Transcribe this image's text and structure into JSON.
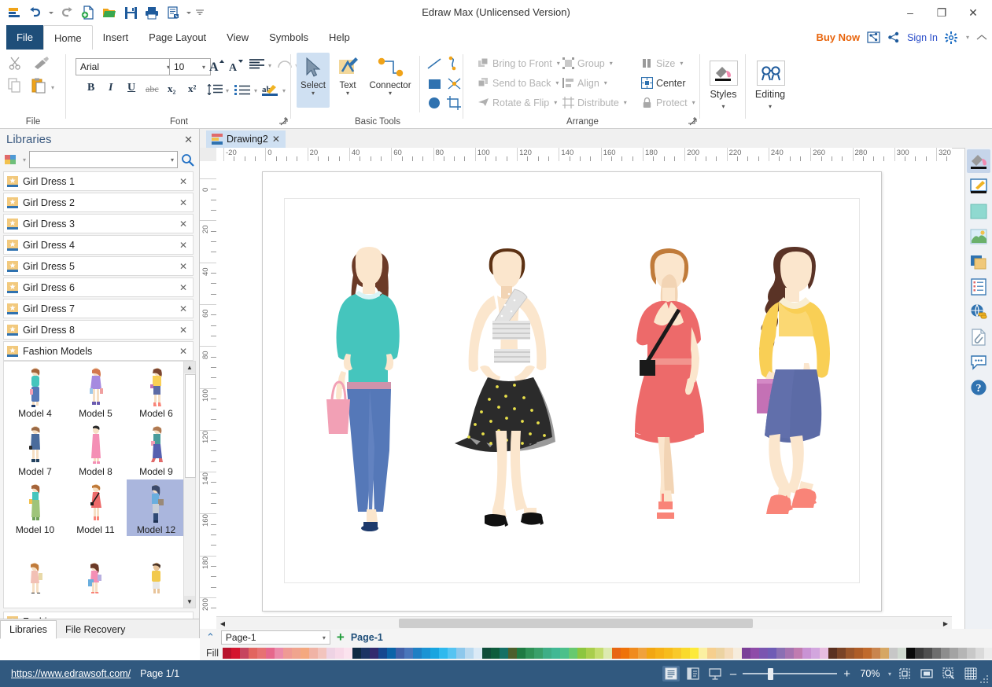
{
  "window": {
    "title": "Edraw Max (Unlicensed Version)",
    "minimize": "–",
    "maximize": "❐",
    "close": "✕"
  },
  "quick_access": [
    {
      "name": "edraw-logo-icon",
      "label": "Edraw"
    },
    {
      "name": "undo-icon",
      "label": "Undo"
    },
    {
      "name": "undo-dropdown-icon",
      "label": "▾"
    },
    {
      "name": "redo-icon",
      "label": "Redo"
    },
    {
      "name": "new-icon",
      "label": "New"
    },
    {
      "name": "open-icon",
      "label": "Open"
    },
    {
      "name": "save-icon",
      "label": "Save"
    },
    {
      "name": "print-icon",
      "label": "Print"
    },
    {
      "name": "export-icon",
      "label": "Export"
    },
    {
      "name": "export-dropdown-icon",
      "label": "▾"
    },
    {
      "name": "customize-qat-icon",
      "label": "≡"
    }
  ],
  "ribbon_tabs": [
    {
      "label": "File",
      "active": false,
      "kind": "file"
    },
    {
      "label": "Home",
      "active": true
    },
    {
      "label": "Insert",
      "active": false
    },
    {
      "label": "Page Layout",
      "active": false
    },
    {
      "label": "View",
      "active": false
    },
    {
      "label": "Symbols",
      "active": false
    },
    {
      "label": "Help",
      "active": false
    }
  ],
  "top_right": {
    "buy_now": "Buy Now",
    "share_box_label": "share-box",
    "share_label": "share",
    "sign_in": "Sign In",
    "settings_label": "settings",
    "settings_caret": "▾",
    "collapse_label": "collapse-ribbon"
  },
  "ribbon": {
    "groups": [
      {
        "name": "file",
        "label": "File"
      },
      {
        "name": "font",
        "label": "Font"
      },
      {
        "name": "basic-tools",
        "label": "Basic Tools"
      },
      {
        "name": "arrange",
        "label": "Arrange"
      }
    ],
    "clipboard": [
      {
        "name": "cut-icon",
        "label": "Cut",
        "enabled": false
      },
      {
        "name": "format-painter-icon",
        "label": "Format Painter",
        "enabled": false
      },
      {
        "name": "copy-icon",
        "label": "Copy",
        "enabled": false
      },
      {
        "name": "paste-icon",
        "label": "Paste",
        "enabled": true
      }
    ],
    "font": {
      "family": "Arial",
      "size": "10",
      "grow_font": "A",
      "shrink_font": "A",
      "bold": "B",
      "italic": "I",
      "underline": "U",
      "strikethrough": "abc",
      "subscript": "x₂",
      "superscript": "x²",
      "line_spacing": "Line Spacing",
      "bullets": "Bullets",
      "highlight": "ab",
      "font_color": "A",
      "align": "Align",
      "curve_text": "Curve Text"
    },
    "basic_tools": [
      {
        "name": "select-tool",
        "label": "Select",
        "selected": true
      },
      {
        "name": "text-tool",
        "label": "Text",
        "selected": false
      },
      {
        "name": "connector-tool",
        "label": "Connector",
        "selected": false
      }
    ],
    "shape_tools": [
      {
        "name": "line-tool",
        "label": "Line"
      },
      {
        "name": "curve-tool",
        "label": "Curve"
      },
      {
        "name": "rectangle-tool",
        "label": "Rectangle"
      },
      {
        "name": "freeform-tool",
        "label": "Freeform"
      },
      {
        "name": "ellipse-tool",
        "label": "Ellipse"
      },
      {
        "name": "crop-tool",
        "label": "Crop"
      }
    ],
    "arrange": [
      {
        "name": "bring-to-front",
        "label": "Bring to Front",
        "caret": true,
        "enabled": false
      },
      {
        "name": "send-to-back",
        "label": "Send to Back",
        "caret": true,
        "enabled": false
      },
      {
        "name": "rotate-flip",
        "label": "Rotate & Flip",
        "caret": true,
        "enabled": false
      },
      {
        "name": "group",
        "label": "Group",
        "caret": true,
        "enabled": false
      },
      {
        "name": "align",
        "label": "Align",
        "caret": true,
        "enabled": false
      },
      {
        "name": "distribute",
        "label": "Distribute",
        "caret": true,
        "enabled": false
      },
      {
        "name": "size",
        "label": "Size",
        "caret": true,
        "enabled": false
      },
      {
        "name": "center",
        "label": "Center",
        "caret": false,
        "enabled": true
      },
      {
        "name": "protect",
        "label": "Protect",
        "caret": true,
        "enabled": false
      }
    ],
    "styles": {
      "label": "Styles",
      "caret": "▾"
    },
    "editing": {
      "label": "Editing",
      "caret": "▾"
    }
  },
  "libraries_panel": {
    "title": "Libraries",
    "close": "✕",
    "search_placeholder": "",
    "search_value": "",
    "search_icon": "search-icon",
    "library_dropdown_caret": "▾",
    "items": [
      {
        "label": "Girl Dress 1"
      },
      {
        "label": "Girl Dress 2"
      },
      {
        "label": "Girl Dress 3"
      },
      {
        "label": "Girl Dress 4"
      },
      {
        "label": "Girl Dress 5"
      },
      {
        "label": "Girl Dress 6"
      },
      {
        "label": "Girl Dress 7"
      },
      {
        "label": "Girl Dress 8"
      },
      {
        "label": "Fashion Models"
      }
    ],
    "bottom_item": {
      "label": "Fashion"
    },
    "shapes": [
      {
        "label": "Model 4",
        "selected": false
      },
      {
        "label": "Model 5",
        "selected": false
      },
      {
        "label": "Model 6",
        "selected": false
      },
      {
        "label": "Model 7",
        "selected": false
      },
      {
        "label": "Model 8",
        "selected": false
      },
      {
        "label": "Model 9",
        "selected": false
      },
      {
        "label": "Model 10",
        "selected": false
      },
      {
        "label": "Model 11",
        "selected": false
      },
      {
        "label": "Model 12",
        "selected": true
      }
    ],
    "tabs": [
      {
        "label": "Libraries",
        "active": true
      },
      {
        "label": "File Recovery",
        "active": false
      }
    ]
  },
  "document": {
    "tab_label": "Drawing2",
    "tab_close": "✕",
    "h_ruler_labels": [
      "-20",
      "0",
      "20",
      "40",
      "60",
      "80",
      "100",
      "120",
      "140",
      "160",
      "180",
      "200",
      "220",
      "240",
      "260",
      "280",
      "300",
      "320"
    ],
    "v_ruler_labels": [
      "0",
      "20",
      "40",
      "60",
      "80",
      "100",
      "120",
      "140",
      "160",
      "180",
      "200"
    ],
    "figures": [
      {
        "name": "model-teal-top-jeans",
        "hair": "#6b3a27",
        "top": "#45c5bd",
        "bottom": "#5578b8",
        "accent": "#f2a0b5",
        "shoe": "#1e3a6b"
      },
      {
        "name": "model-polka-skirt",
        "hair": "#5c3113",
        "top": "#d8d8d8",
        "bottom": "#2b2b2b",
        "accent": "#e8e04a",
        "shoe": "#111111"
      },
      {
        "name": "model-red-dress",
        "hair": "#c07b3a",
        "top": "#ed6a6a",
        "bottom": "#ed6a6a",
        "accent": "#1a1a1a",
        "shoe": "#f98478"
      },
      {
        "name": "model-yellow-top-skirt",
        "hair": "#5a3326",
        "top": "#f9cf55",
        "bottom": "#5c6ba6",
        "accent": "#c471b5",
        "shoe": "#f98478"
      }
    ]
  },
  "right_toolbar": [
    {
      "name": "fill-icon",
      "selected": true
    },
    {
      "name": "pen-edit-icon",
      "selected": false
    },
    {
      "name": "fill-color-icon",
      "selected": false
    },
    {
      "name": "picture-icon",
      "selected": false
    },
    {
      "name": "layers-icon",
      "selected": false
    },
    {
      "name": "properties-icon",
      "selected": false
    },
    {
      "name": "hyperlink-icon",
      "selected": false
    },
    {
      "name": "attachment-icon",
      "selected": false
    },
    {
      "name": "comment-icon",
      "selected": false
    },
    {
      "name": "help-icon",
      "selected": false
    }
  ],
  "page_bar": {
    "collapse_caret": "⌃",
    "page_select_value": "Page-1",
    "page_select_caret": "▾",
    "add_page": "+",
    "active_page": "Page-1",
    "fill_label": "Fill",
    "swatches": [
      "#b8122b",
      "#d4152e",
      "#c6455f",
      "#e2645f",
      "#e77172",
      "#e6678c",
      "#eb8aaa",
      "#ef9a94",
      "#f0a48e",
      "#f4a87f",
      "#f0b3a5",
      "#f2c4bd",
      "#eed3e4",
      "#f7d9e8",
      "#fbe3ee",
      "#102a43",
      "#1c3464",
      "#322a6e",
      "#15478f",
      "#0b63a8",
      "#4160a8",
      "#4a76bb",
      "#1f7fc4",
      "#1b93d4",
      "#18a5e0",
      "#2fb9ee",
      "#55c4f2",
      "#8dc8ec",
      "#b9d9ef",
      "#dbeaf6",
      "#0f4d3a",
      "#0e5c3c",
      "#157065",
      "#4c5f2c",
      "#1e7a42",
      "#2f9156",
      "#3aa06a",
      "#3fae86",
      "#41b894",
      "#4cc08a",
      "#67c96f",
      "#8cc63f",
      "#a9ce4c",
      "#c4dd6e",
      "#ddeab0",
      "#e86612",
      "#ef7209",
      "#f08b1e",
      "#f0a23c",
      "#f2a612",
      "#f6b117",
      "#f7bc1c",
      "#f9c92a",
      "#fada2c",
      "#fdea3a",
      "#fbf0a1",
      "#f6cf8e",
      "#ecd3a2",
      "#f4dcbb",
      "#f6ecdc",
      "#7b3f98",
      "#8e4ba8",
      "#7a55b0",
      "#6f5cb5",
      "#8a6fb3",
      "#a573b0",
      "#c07cb0",
      "#c993d4",
      "#d2a6de",
      "#e7bde0",
      "#5a3020",
      "#7a4326",
      "#9a552a",
      "#ae5d27",
      "#c06a2c",
      "#c9854e",
      "#d6a764",
      "#c7c7c7",
      "#cfd9cf",
      "#0a0a0a",
      "#3a3a3a",
      "#4f4f4f",
      "#6e6e6e",
      "#8d8d8d",
      "#a3a3a3",
      "#b5b5b5",
      "#c8c8c8",
      "#dadada",
      "#ececec",
      "#fafafa"
    ]
  },
  "status_bar": {
    "url": "https://www.edrawsoft.com/",
    "page_info": "Page 1/1",
    "view_buttons": [
      {
        "name": "normal-view-button",
        "selected": true
      },
      {
        "name": "split-view-button",
        "selected": false
      },
      {
        "name": "presentation-view-button",
        "selected": false
      }
    ],
    "zoom_out": "–",
    "zoom_in": "+",
    "zoom_level": "70%",
    "zoom_caret": "▾",
    "fit_page_button": "fit-page-icon",
    "fit_width_button": "fit-width-icon",
    "zoom_selection_button": "zoom-selection-icon",
    "grid_button": "grid-icon"
  }
}
